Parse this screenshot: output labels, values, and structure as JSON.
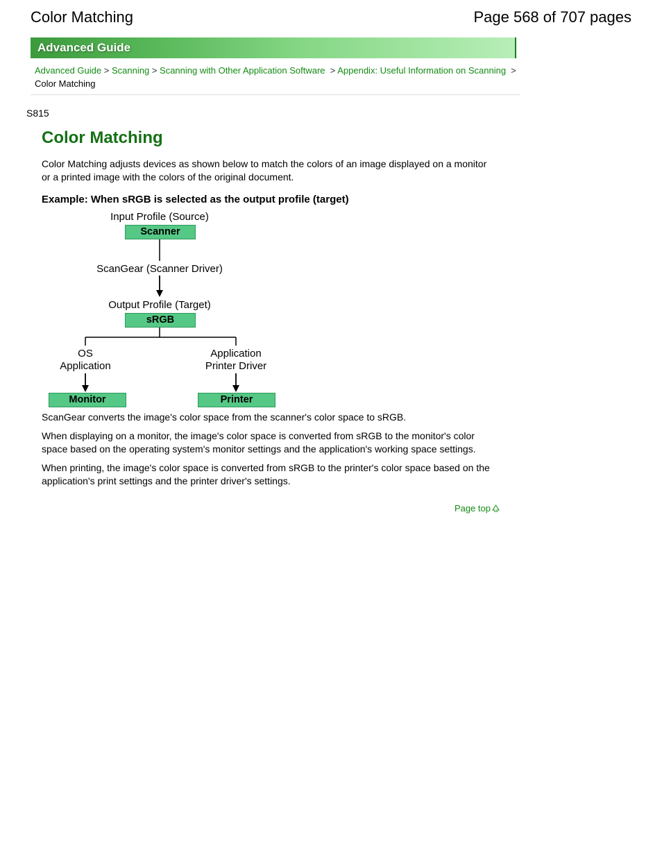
{
  "header": {
    "title": "Color Matching",
    "page_label": "Page 568 of 707 pages"
  },
  "banner": {
    "label": "Advanced Guide"
  },
  "breadcrumb": {
    "links": [
      "Advanced Guide",
      "Scanning",
      "Scanning with Other Application Software",
      "Appendix: Useful Information on Scanning"
    ],
    "sep": ">",
    "current": "Color Matching"
  },
  "doc_code": "S815",
  "section": {
    "title": "Color Matching",
    "intro": "Color Matching adjusts devices as shown below to match the colors of an image displayed on a monitor or a printed image with the colors of the original document.",
    "example_heading": "Example: When sRGB is selected as the output profile (target)",
    "paras": [
      "ScanGear converts the image's color space from the scanner's color space to sRGB.",
      "When displaying on a monitor, the image's color space is converted from sRGB to the monitor's color space based on the operating system's monitor settings and the application's working space settings.",
      "When printing, the image's color space is converted from sRGB to the printer's color space based on the application's print settings and the printer driver's settings."
    ]
  },
  "diagram": {
    "input_label": "Input Profile (Source)",
    "scanner": "Scanner",
    "driver": "ScanGear (Scanner Driver)",
    "output_label": "Output Profile (Target)",
    "srgb": "sRGB",
    "left_top": "OS",
    "left_bottom": "Application",
    "right_top": "Application",
    "right_bottom": "Printer Driver",
    "monitor": "Monitor",
    "printer": "Printer"
  },
  "page_top": "Page top"
}
